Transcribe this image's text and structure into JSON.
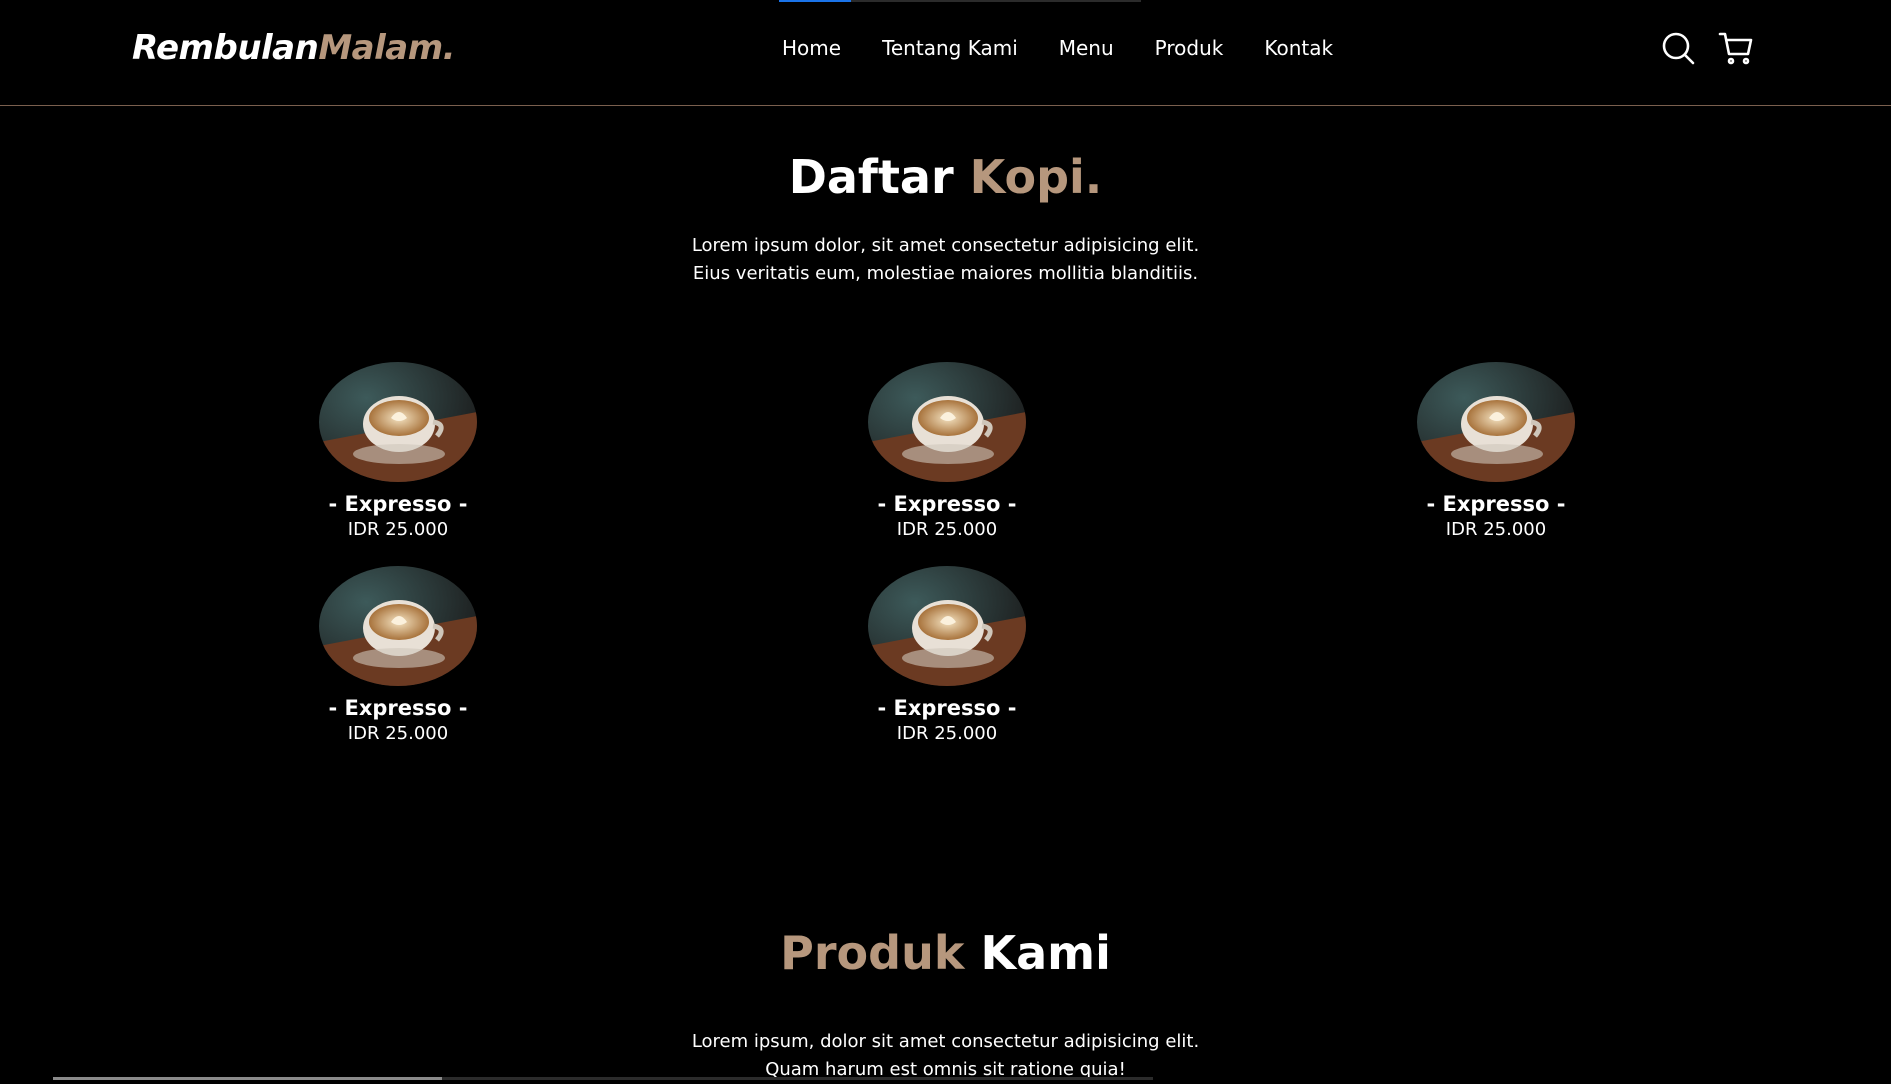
{
  "brand": {
    "name_part1": "Rembulan",
    "name_part2": "Malam."
  },
  "nav": {
    "links": [
      "Home",
      "Tentang Kami",
      "Menu",
      "Produk",
      "Kontak"
    ],
    "icons": [
      "search-icon",
      "shopping-cart-icon"
    ]
  },
  "menu_section": {
    "title_part1": "Daftar ",
    "title_part2": "Kopi.",
    "desc_line1": "Lorem ipsum dolor, sit amet consectetur adipisicing elit.",
    "desc_line2": "Eius veritatis eum, molestiae maiores mollitia blanditiis."
  },
  "menu_items": [
    {
      "name": "- Expresso -",
      "price": "IDR 25.000"
    },
    {
      "name": "- Expresso -",
      "price": "IDR 25.000"
    },
    {
      "name": "- Expresso -",
      "price": "IDR 25.000"
    },
    {
      "name": "- Expresso -",
      "price": "IDR 25.000"
    },
    {
      "name": "- Expresso -",
      "price": "IDR 25.000"
    }
  ],
  "products_section": {
    "title_part1": "Produk ",
    "title_part2": "Kami",
    "desc_line1": "Lorem ipsum, dolor sit amet consectetur adipisicing elit.",
    "desc_line2": "Quam harum est omnis sit ratione quia!"
  },
  "colors": {
    "background": "#000000",
    "accent": "#b6977d",
    "text": "#ffffff",
    "divider": "#7a5f4e"
  }
}
